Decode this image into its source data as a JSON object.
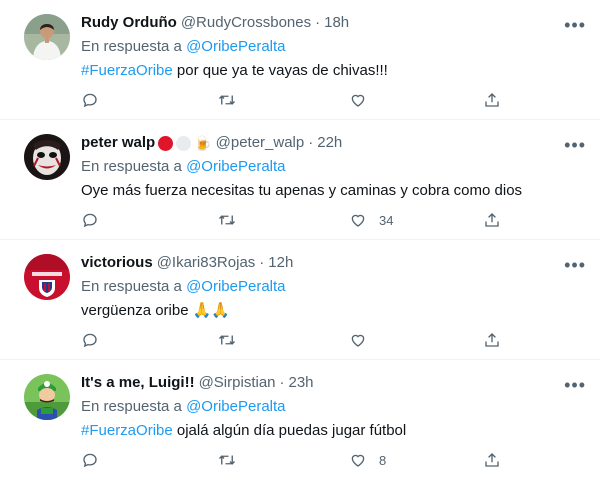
{
  "tweets": [
    {
      "name": "Rudy Orduño",
      "handle": "@RudyCrossbones",
      "separator": "·",
      "time": "18h",
      "reply_prefix": "En respuesta a",
      "reply_to": "@OribePeralta",
      "hashtag": "#FuerzaOribe",
      "text": " por que ya te vayas de chivas!!!",
      "likes": ""
    },
    {
      "name": "peter walp",
      "handle": "@peter_walp",
      "separator": "·",
      "time": "22h",
      "reply_prefix": "En respuesta a",
      "reply_to": "@OribePeralta",
      "text": "Oye más fuerza necesitas tu apenas y caminas y cobra como dios",
      "likes": "34",
      "name_emoji": "🍺"
    },
    {
      "name": "victorious",
      "handle": "@Ikari83Rojas",
      "separator": "·",
      "time": "12h",
      "reply_prefix": "En respuesta a",
      "reply_to": "@OribePeralta",
      "text": "vergüenza oribe",
      "text_emoji": "🙏🙏",
      "likes": ""
    },
    {
      "name": "It's a me, Luigi!!",
      "handle": "@Sirpistian",
      "separator": "·",
      "time": "23h",
      "reply_prefix": "En respuesta a",
      "reply_to": "@OribePeralta",
      "hashtag": "#FuerzaOribe",
      "text": " ojalá algún día puedas jugar fútbol",
      "likes": "8"
    }
  ],
  "more_label": "•••",
  "colors": {
    "link": "#1d9bf0",
    "muted": "#536471",
    "text": "#0f1419",
    "divider": "#eff3f4"
  },
  "icons": {
    "reply": "reply-icon",
    "retweet": "retweet-icon",
    "like": "heart-icon",
    "share": "share-icon",
    "more": "more-icon"
  }
}
